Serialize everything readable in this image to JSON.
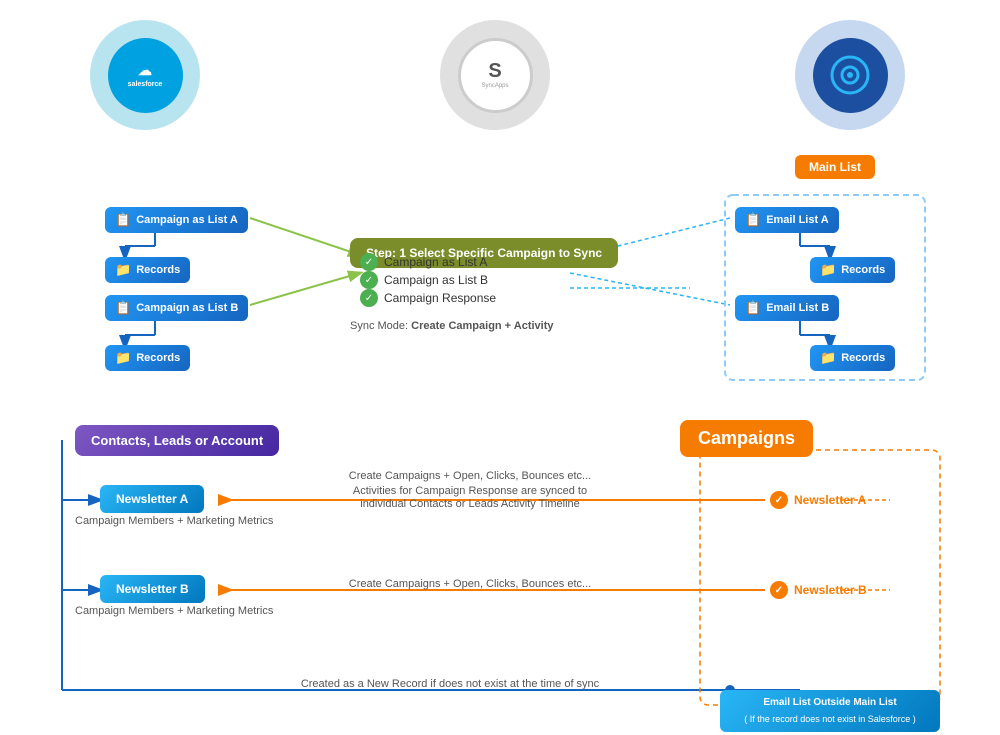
{
  "logos": {
    "salesforce": {
      "text": "salesforce",
      "sub": ""
    },
    "syncapps": {
      "text": "S",
      "sub": "SyncApps"
    },
    "ctct": {
      "text": "●"
    }
  },
  "header_labels": {
    "main_list": "Main List"
  },
  "top_section": {
    "campaign_list_a": "Campaign as List A",
    "campaign_list_b": "Campaign as List B",
    "records_1": "Records",
    "records_2": "Records",
    "email_list_a": "Email List A",
    "email_list_b": "Email List B",
    "records_3": "Records",
    "records_4": "Records",
    "step_label": "Step: 1 Select Specific Campaign to Sync",
    "check1": "Campaign as List A",
    "check2": "Campaign as List B",
    "check3": "Campaign Response",
    "sync_mode_label": "Sync Mode:",
    "sync_mode_value": "Create Campaign + Activity"
  },
  "bottom_section": {
    "contacts_label": "Contacts, Leads or Account",
    "campaigns_label": "Campaigns",
    "newsletter_a": "Newsletter A",
    "newsletter_b": "Newsletter B",
    "newsletter_a_tag": "Newsletter A",
    "newsletter_b_tag": "Newsletter B",
    "members_label_a": "Campaign Members + Marketing Metrics",
    "members_label_b": "Campaign Members + Marketing Metrics",
    "flow_text_a1": "Create Campaigns + Open, Clicks, Bounces etc...",
    "flow_text_a2": "Activities for Campaign Response are synced to",
    "flow_text_a3": "individual Contacts or Leads Activity Timeline",
    "flow_text_b": "Create Campaigns + Open, Clicks, Bounces etc...",
    "new_record_text": "Created as a New Record if does not exist at the time of sync",
    "email_outside": "Email List Outside Main List",
    "email_outside_sub": "( If the record does not exist in Salesforce )"
  }
}
